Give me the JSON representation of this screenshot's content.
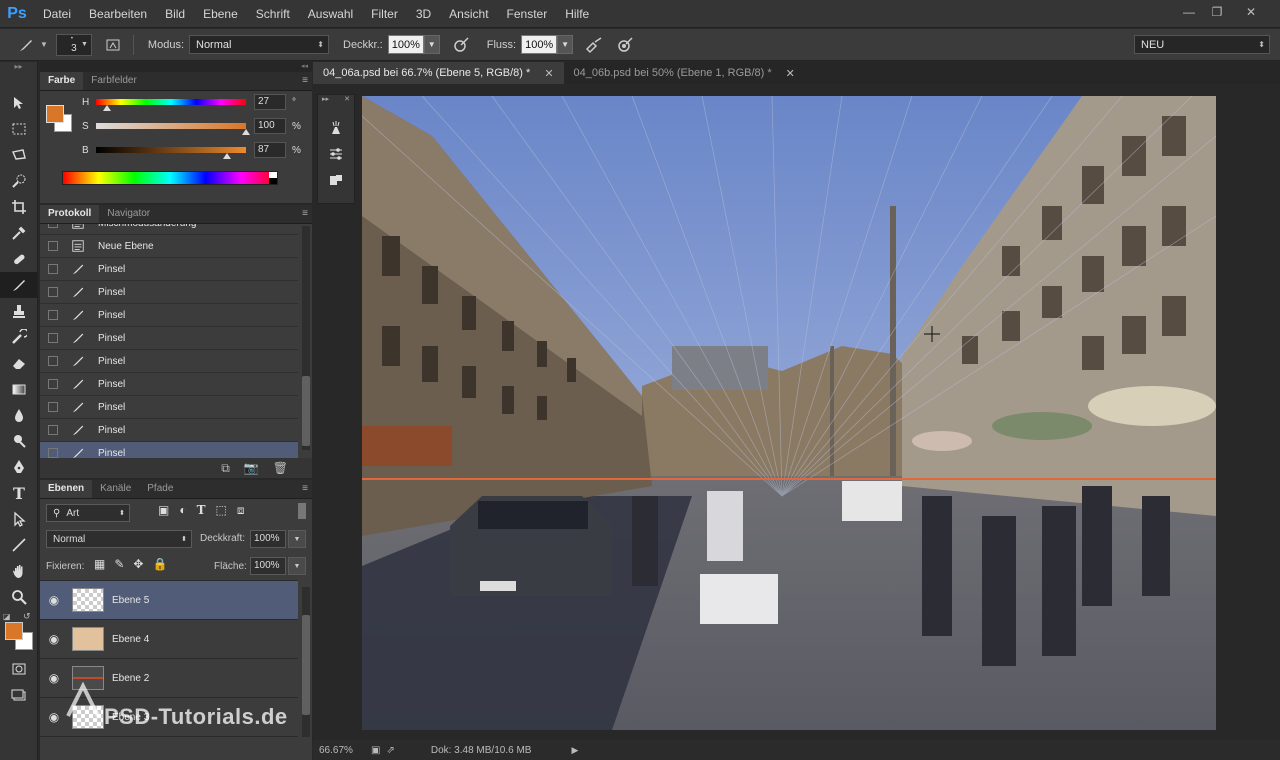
{
  "app": {
    "logo": "Ps"
  },
  "menu": [
    "Datei",
    "Bearbeiten",
    "Bild",
    "Ebene",
    "Schrift",
    "Auswahl",
    "Filter",
    "3D",
    "Ansicht",
    "Fenster",
    "Hilfe"
  ],
  "window_controls": {
    "minimize": "—",
    "restore": "❐",
    "close": "✕"
  },
  "options": {
    "brush_size": "3",
    "mode_label": "Modus:",
    "mode_value": "Normal",
    "opacity_label": "Deckkr.:",
    "opacity_value": "100%",
    "flow_label": "Fluss:",
    "flow_value": "100%",
    "workspace": "NEU"
  },
  "color_panel": {
    "tabs": [
      "Farbe",
      "Farbfelder"
    ],
    "h_label": "H",
    "h_value": "27",
    "h_unit": "°",
    "s_label": "S",
    "s_value": "100",
    "s_unit": "%",
    "b_label": "B",
    "b_value": "87",
    "b_unit": "%",
    "fg_color": "#d97627",
    "bg_color": "#ffffff",
    "h_level": 0.075,
    "s_level": 1.0,
    "b_level": 0.87
  },
  "history_panel": {
    "tabs": [
      "Protokoll",
      "Navigator"
    ],
    "items": [
      {
        "label": "Mischmodusänderung",
        "icon": "document-icon"
      },
      {
        "label": "Neue Ebene",
        "icon": "document-icon"
      },
      {
        "label": "Pinsel",
        "icon": "brush-icon"
      },
      {
        "label": "Pinsel",
        "icon": "brush-icon"
      },
      {
        "label": "Pinsel",
        "icon": "brush-icon"
      },
      {
        "label": "Pinsel",
        "icon": "brush-icon"
      },
      {
        "label": "Pinsel",
        "icon": "brush-icon"
      },
      {
        "label": "Pinsel",
        "icon": "brush-icon"
      },
      {
        "label": "Pinsel",
        "icon": "brush-icon"
      },
      {
        "label": "Pinsel",
        "icon": "brush-icon"
      },
      {
        "label": "Pinsel",
        "icon": "brush-icon",
        "selected": true
      }
    ]
  },
  "layers_panel": {
    "tabs": [
      "Ebenen",
      "Kanäle",
      "Pfade"
    ],
    "filter_value": "Art",
    "blend_mode": "Normal",
    "opacity_label": "Deckkraft:",
    "opacity_value": "100%",
    "lock_label": "Fixieren:",
    "fill_label": "Fläche:",
    "fill_value": "100%",
    "layers": [
      {
        "name": "Ebene 5",
        "thumb": "transparent",
        "selected": true
      },
      {
        "name": "Ebene 4",
        "thumb": "#e2c29c"
      },
      {
        "name": "Ebene 2",
        "thumb": "line"
      },
      {
        "name": "Ebene 3",
        "thumb": "transparent"
      }
    ]
  },
  "documents": {
    "tabs": [
      {
        "label": "04_06a.psd bei 66.7% (Ebene 5, RGB/8) *",
        "active": true
      },
      {
        "label": "04_06b.psd bei 50% (Ebene 1, RGB/8) *",
        "active": false
      }
    ]
  },
  "status": {
    "zoom": "66.67%",
    "doc_info": "Dok: 3.48 MB/10.6 MB"
  },
  "watermark": "PSD-Tutorials.de"
}
